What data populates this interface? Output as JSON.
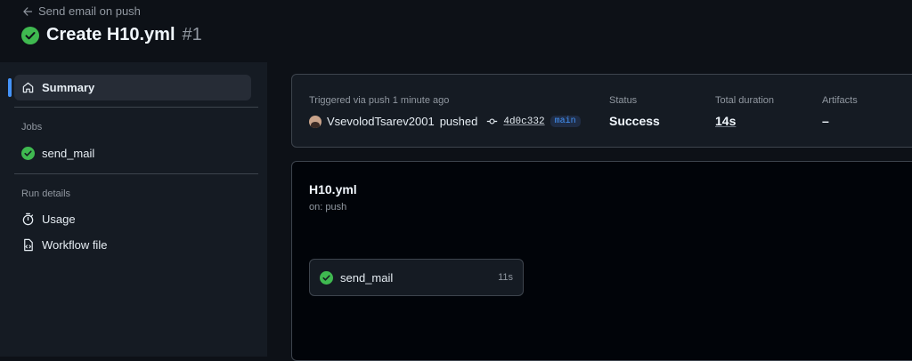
{
  "header": {
    "back_label": "Send email on push",
    "title": "Create H10.yml",
    "run_number": "#1",
    "status_icon": "check-circle-icon"
  },
  "sidebar": {
    "summary_label": "Summary",
    "jobs_heading": "Jobs",
    "jobs": [
      {
        "label": "send_mail",
        "status": "success"
      }
    ],
    "run_details_heading": "Run details",
    "usage_label": "Usage",
    "workflow_file_label": "Workflow file"
  },
  "summary": {
    "trigger_text": "Triggered via push 1 minute ago",
    "actor": "VsevolodTsarev2001",
    "action": "pushed",
    "commit_sha": "4d0c332",
    "branch": "main",
    "status_label": "Status",
    "status_value": "Success",
    "duration_label": "Total duration",
    "duration_value": "14s",
    "artifacts_label": "Artifacts",
    "artifacts_value": "–"
  },
  "graph": {
    "workflow_name": "H10.yml",
    "trigger": "on: push",
    "job": {
      "name": "send_mail",
      "duration": "11s",
      "status": "success"
    }
  },
  "colors": {
    "background": "#0d1117",
    "sidebar_bg": "#151b23",
    "success_green": "#3fb950",
    "accent_blue": "#4493f8",
    "muted_text": "#9198a1",
    "border": "#3d444d"
  }
}
